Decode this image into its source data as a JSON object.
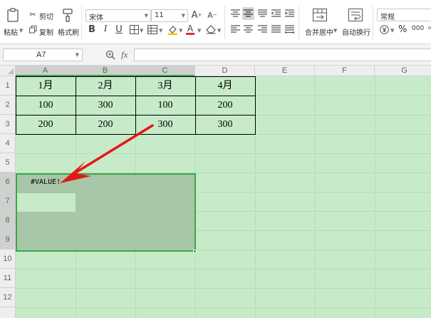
{
  "ribbon": {
    "paste_label": "粘贴",
    "cut_label": "剪切",
    "copy_label": "复制",
    "format_painter_label": "格式刷",
    "font_name": "宋体",
    "font_size": "11",
    "bold": "B",
    "italic": "I",
    "underline": "U",
    "font_color_glyph": "A",
    "merge_center_label": "合并居中",
    "wrap_text_label": "自动换行",
    "number_format": "常规",
    "percent": "%",
    "thousands": "000",
    "colors": {
      "font_color": "#e03030",
      "fill_color": "#f3c800",
      "accent_green": "#3aa74a"
    }
  },
  "formula_bar": {
    "name_box": "A7",
    "fx_label": "fx",
    "formula": ""
  },
  "sheet": {
    "columns": [
      "A",
      "B",
      "C",
      "D",
      "E",
      "F",
      "G"
    ],
    "rows": [
      "1",
      "2",
      "3",
      "4",
      "5",
      "6",
      "7",
      "8",
      "9",
      "10",
      "11",
      "12"
    ],
    "table": [
      [
        "1月",
        "2月",
        "3月",
        "4月"
      ],
      [
        "100",
        "300",
        "100",
        "200"
      ],
      [
        "200",
        "200",
        "300",
        "300"
      ]
    ],
    "error_cell_value": "#VALUE!",
    "active_cell": "A7",
    "selected_range": "A6:C9"
  }
}
